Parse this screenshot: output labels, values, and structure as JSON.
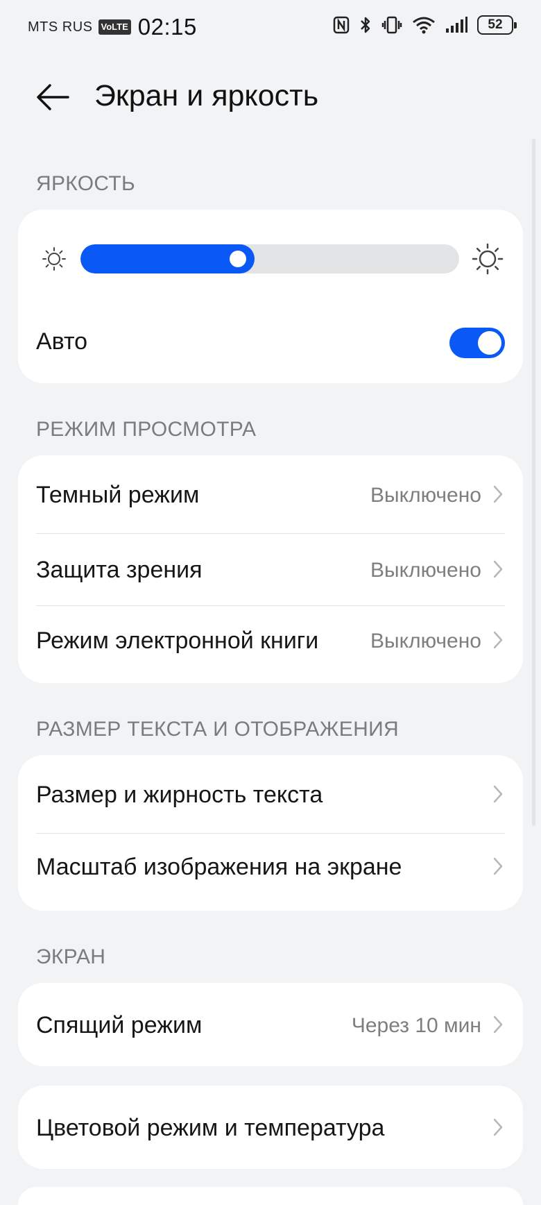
{
  "status": {
    "carrier": "MTS RUS",
    "volte": "VoLTE",
    "time": "02:15",
    "battery": "52",
    "icons": [
      "nfc-icon",
      "bluetooth-icon",
      "vibrate-icon",
      "wifi-icon",
      "signal-icon",
      "battery-icon"
    ]
  },
  "header": {
    "title": "Экран и яркость"
  },
  "brightness": {
    "section_label": "ЯРКОСТЬ",
    "level": 0.46,
    "auto_label": "Авто",
    "auto_enabled": true
  },
  "view_mode": {
    "section_label": "РЕЖИМ ПРОСМОТРА",
    "items": [
      {
        "label": "Темный режим",
        "value": "Выключено"
      },
      {
        "label": "Защита зрения",
        "value": "Выключено"
      },
      {
        "label": "Режим электронной книги",
        "value": "Выключено"
      }
    ]
  },
  "text_size": {
    "section_label": "РАЗМЕР ТЕКСТА И ОТОБРАЖЕНИЯ",
    "items": [
      {
        "label": "Размер и жирность текста"
      },
      {
        "label": "Масштаб изображения на экране"
      }
    ]
  },
  "screen": {
    "section_label": "ЭКРАН",
    "sleep": {
      "label": "Спящий режим",
      "value": "Через 10 мин"
    },
    "color": {
      "label": "Цветовой режим и температура"
    }
  },
  "colors": {
    "accent": "#0a59f7",
    "background": "#f1f3f5",
    "card": "#ffffff"
  }
}
